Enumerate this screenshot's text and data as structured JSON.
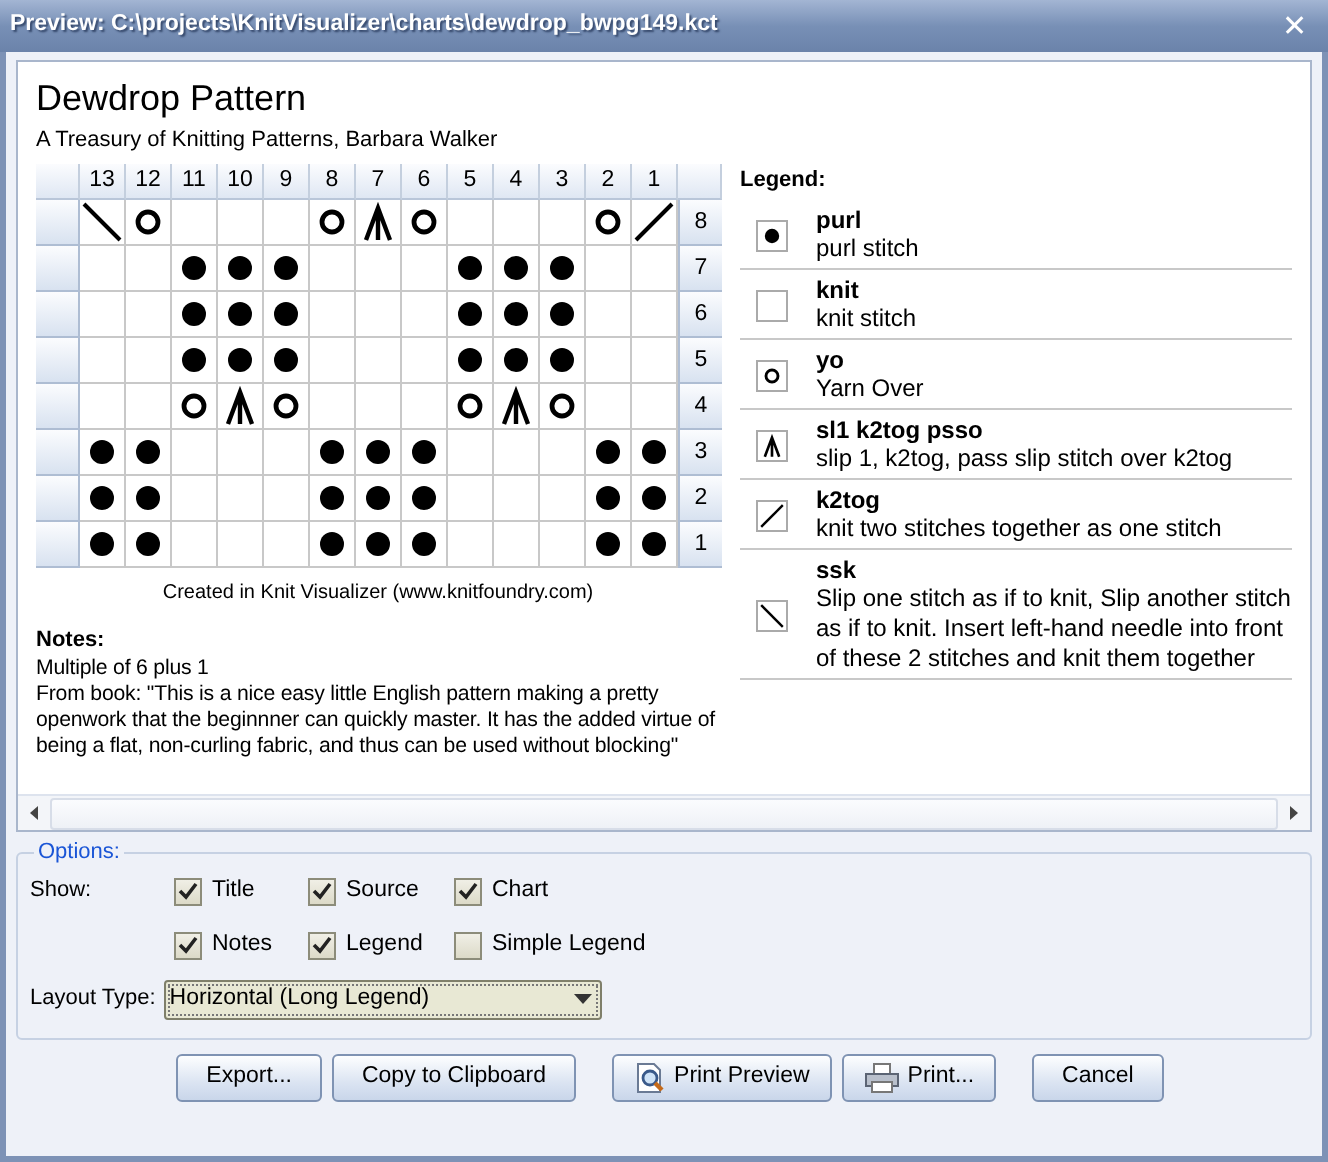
{
  "window": {
    "title": "Preview: C:\\projects\\KnitVisualizer\\charts\\dewdrop_bwpg149.kct",
    "close": "✕"
  },
  "title": "Dewdrop Pattern",
  "source": "A Treasury of Knitting Patterns, Barbara Walker",
  "chart": {
    "columns": [
      "13",
      "12",
      "11",
      "10",
      "9",
      "8",
      "7",
      "6",
      "5",
      "4",
      "3",
      "2",
      "1"
    ],
    "rows": [
      {
        "label": "8",
        "cells": [
          {
            "kind": "ssk"
          },
          {
            "kind": "yo"
          },
          {
            "kind": "knit"
          },
          {
            "kind": "knit"
          },
          {
            "kind": "knit"
          },
          {
            "kind": "yo"
          },
          {
            "kind": "sl1k2togpsso"
          },
          {
            "kind": "yo"
          },
          {
            "kind": "knit"
          },
          {
            "kind": "knit"
          },
          {
            "kind": "knit"
          },
          {
            "kind": "yo"
          },
          {
            "kind": "k2tog"
          }
        ]
      },
      {
        "label": "7",
        "cells": [
          {
            "kind": "knit"
          },
          {
            "kind": "knit"
          },
          {
            "kind": "purl"
          },
          {
            "kind": "purl"
          },
          {
            "kind": "purl"
          },
          {
            "kind": "knit"
          },
          {
            "kind": "knit"
          },
          {
            "kind": "knit"
          },
          {
            "kind": "purl"
          },
          {
            "kind": "purl"
          },
          {
            "kind": "purl"
          },
          {
            "kind": "knit"
          },
          {
            "kind": "knit"
          }
        ]
      },
      {
        "label": "6",
        "cells": [
          {
            "kind": "knit"
          },
          {
            "kind": "knit"
          },
          {
            "kind": "purl"
          },
          {
            "kind": "purl"
          },
          {
            "kind": "purl"
          },
          {
            "kind": "knit"
          },
          {
            "kind": "knit"
          },
          {
            "kind": "knit"
          },
          {
            "kind": "purl"
          },
          {
            "kind": "purl"
          },
          {
            "kind": "purl"
          },
          {
            "kind": "knit"
          },
          {
            "kind": "knit"
          }
        ]
      },
      {
        "label": "5",
        "cells": [
          {
            "kind": "knit"
          },
          {
            "kind": "knit"
          },
          {
            "kind": "purl"
          },
          {
            "kind": "purl"
          },
          {
            "kind": "purl"
          },
          {
            "kind": "knit"
          },
          {
            "kind": "knit"
          },
          {
            "kind": "knit"
          },
          {
            "kind": "purl"
          },
          {
            "kind": "purl"
          },
          {
            "kind": "purl"
          },
          {
            "kind": "knit"
          },
          {
            "kind": "knit"
          }
        ]
      },
      {
        "label": "4",
        "cells": [
          {
            "kind": "knit"
          },
          {
            "kind": "knit"
          },
          {
            "kind": "yo"
          },
          {
            "kind": "sl1k2togpsso"
          },
          {
            "kind": "yo"
          },
          {
            "kind": "knit"
          },
          {
            "kind": "knit"
          },
          {
            "kind": "knit"
          },
          {
            "kind": "yo"
          },
          {
            "kind": "sl1k2togpsso"
          },
          {
            "kind": "yo"
          },
          {
            "kind": "knit"
          },
          {
            "kind": "knit"
          }
        ]
      },
      {
        "label": "3",
        "cells": [
          {
            "kind": "purl"
          },
          {
            "kind": "purl"
          },
          {
            "kind": "knit"
          },
          {
            "kind": "knit"
          },
          {
            "kind": "knit"
          },
          {
            "kind": "purl"
          },
          {
            "kind": "purl"
          },
          {
            "kind": "purl"
          },
          {
            "kind": "knit"
          },
          {
            "kind": "knit"
          },
          {
            "kind": "knit"
          },
          {
            "kind": "purl"
          },
          {
            "kind": "purl"
          }
        ]
      },
      {
        "label": "2",
        "cells": [
          {
            "kind": "purl"
          },
          {
            "kind": "purl"
          },
          {
            "kind": "knit"
          },
          {
            "kind": "knit"
          },
          {
            "kind": "knit"
          },
          {
            "kind": "purl"
          },
          {
            "kind": "purl"
          },
          {
            "kind": "purl"
          },
          {
            "kind": "knit"
          },
          {
            "kind": "knit"
          },
          {
            "kind": "knit"
          },
          {
            "kind": "purl"
          },
          {
            "kind": "purl"
          }
        ]
      },
      {
        "label": "1",
        "cells": [
          {
            "kind": "purl"
          },
          {
            "kind": "purl"
          },
          {
            "kind": "knit"
          },
          {
            "kind": "knit"
          },
          {
            "kind": "knit"
          },
          {
            "kind": "purl"
          },
          {
            "kind": "purl"
          },
          {
            "kind": "purl"
          },
          {
            "kind": "knit"
          },
          {
            "kind": "knit"
          },
          {
            "kind": "knit"
          },
          {
            "kind": "purl"
          },
          {
            "kind": "purl"
          }
        ]
      }
    ]
  },
  "credit": "Created in Knit Visualizer (www.knitfoundry.com)",
  "notes": {
    "heading": "Notes:",
    "lines": [
      "Multiple of 6 plus 1",
      "From book: \"This is a nice easy little English pattern making a  pretty openwork that the beginnner can quickly master. It has the added virtue of being a flat, non-curling fabric, and thus can be used without blocking\""
    ]
  },
  "legend": {
    "heading": "Legend:",
    "items": [
      {
        "kind": "purl",
        "name": "purl",
        "description": "purl stitch"
      },
      {
        "kind": "knit",
        "name": "knit",
        "description": "knit stitch"
      },
      {
        "kind": "yo",
        "name": "yo",
        "description": "Yarn Over"
      },
      {
        "kind": "sl1k2togpsso",
        "name": "sl1 k2tog psso",
        "description": "slip 1, k2tog, pass slip stitch over k2tog"
      },
      {
        "kind": "k2tog",
        "name": "k2tog",
        "description": "knit two stitches together as one stitch"
      },
      {
        "kind": "ssk",
        "name": "ssk",
        "description": "Slip one stitch as if to knit, Slip another stitch as if to knit. Insert left-hand needle into front of these 2 stitches and knit them together"
      }
    ]
  },
  "options": {
    "legend": "Options:",
    "show_label": "Show:",
    "checkboxes": [
      {
        "label": "Title",
        "checked": true
      },
      {
        "label": "Source",
        "checked": true
      },
      {
        "label": "Chart",
        "checked": true
      },
      {
        "label": "Notes",
        "checked": true
      },
      {
        "label": "Legend",
        "checked": true
      },
      {
        "label": "Simple Legend",
        "checked": false
      }
    ],
    "layout_label": "Layout Type:",
    "layout_value": "Horizontal (Long Legend)"
  },
  "buttons": [
    {
      "label": "Export..."
    },
    {
      "label": "Copy to Clipboard"
    },
    {
      "label": "Print Preview"
    },
    {
      "label": "Print..."
    },
    {
      "label": "Cancel"
    }
  ]
}
